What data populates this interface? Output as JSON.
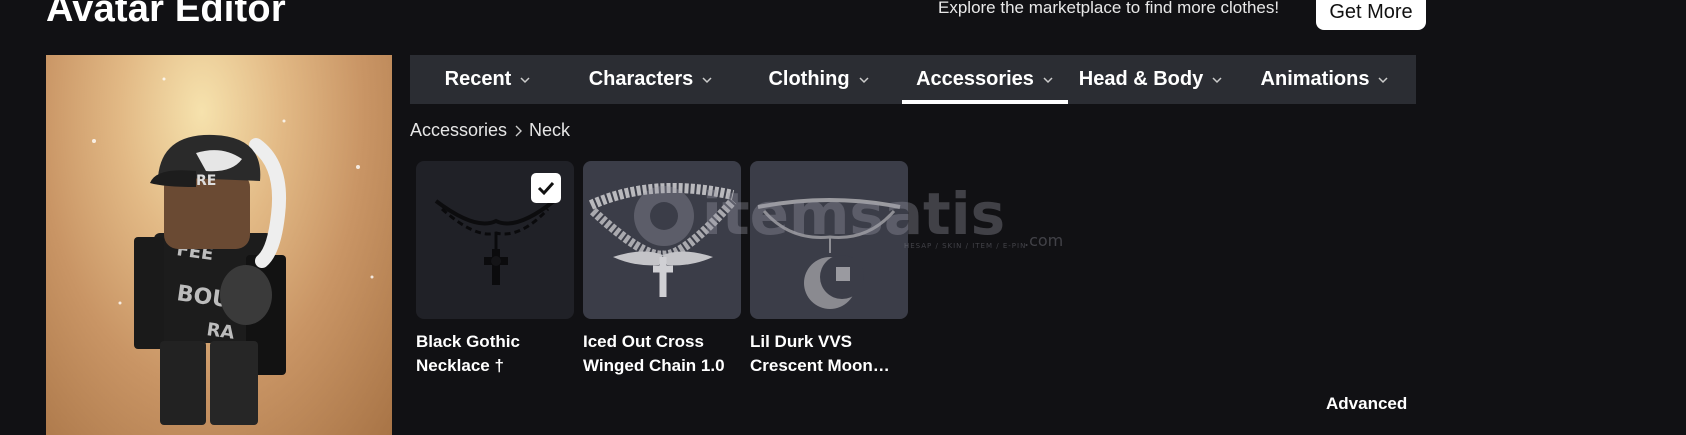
{
  "header": {
    "title": "Avatar Editor",
    "explore_text": "Explore the marketplace to find more clothes!",
    "get_more_label": "Get More"
  },
  "tabs": [
    {
      "label": "Recent",
      "active": false
    },
    {
      "label": "Characters",
      "active": false
    },
    {
      "label": "Clothing",
      "active": false
    },
    {
      "label": "Accessories",
      "active": true
    },
    {
      "label": "Head & Body",
      "active": false
    },
    {
      "label": "Animations",
      "active": false
    }
  ],
  "breadcrumb": {
    "parent": "Accessories",
    "current": "Neck"
  },
  "items": [
    {
      "name": "Black Gothic Necklace †",
      "selected": true
    },
    {
      "name": "Iced Out Cross Winged Chain 1.0",
      "selected": false
    },
    {
      "name": "Lil Durk VVS Crescent Moon…",
      "selected": false
    }
  ],
  "advanced_label": "Advanced",
  "watermark": {
    "brand": "itemsatis",
    "tld": ".com",
    "tagline": "HESAP / SKIN / ITEM / E-PIN"
  },
  "colors": {
    "background": "#111114",
    "tab_bar": "#2b2d33",
    "card_dark": "#202127",
    "card_grey": "#3b3d48"
  }
}
